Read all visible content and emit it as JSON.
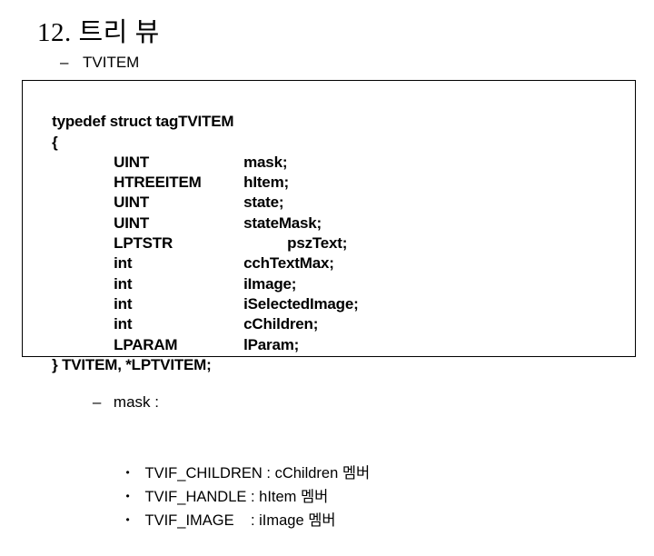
{
  "slide": {
    "title": "12. 트리 뷰",
    "subtitle_dash": "–",
    "subtitle": "TVITEM"
  },
  "code_block": {
    "header": "typedef struct tagTVITEM",
    "open_brace": "{",
    "fields": [
      {
        "type": "UINT",
        "name": "mask;"
      },
      {
        "type": "HTREEITEM",
        "name": "hItem;"
      },
      {
        "type": "UINT",
        "name": "state;"
      },
      {
        "type": "UINT",
        "name": "stateMask;"
      },
      {
        "type": "LPTSTR",
        "name": "pszText;",
        "extra_indent": true
      },
      {
        "type": "int",
        "name": "cchTextMax;"
      },
      {
        "type": "int",
        "name": "iImage;"
      },
      {
        "type": "int",
        "name": "iSelectedImage;"
      },
      {
        "type": "int",
        "name": "cChildren;"
      },
      {
        "type": "LPARAM",
        "name": "lParam;"
      }
    ],
    "close_line": "} TVITEM, *LPTVITEM;"
  },
  "mask_section": {
    "dash": "–",
    "heading": "mask :",
    "bullet_char": "•",
    "items": [
      {
        "flag": "TVIF_CHILDREN",
        "separator": " : ",
        "member": "cChildren 멤버"
      },
      {
        "flag": "TVIF_HANDLE",
        "separator": " : ",
        "member": "hItem 멤버"
      },
      {
        "flag": "TVIF_IMAGE",
        "separator": "    : ",
        "member": "iImage 멤버"
      }
    ]
  },
  "colors": {
    "background": "#ffffff",
    "text": "#000000",
    "border": "#000000"
  }
}
